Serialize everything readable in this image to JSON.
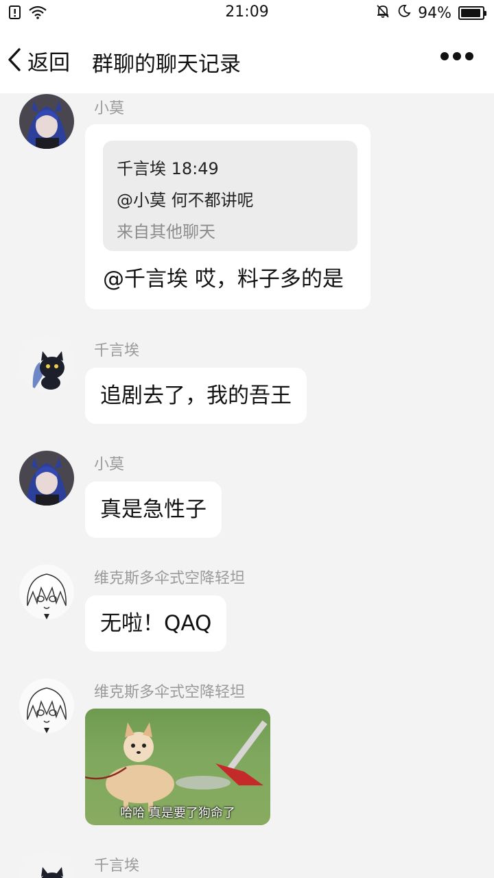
{
  "status_bar": {
    "time": "21:09",
    "battery": "94%",
    "icons": [
      "sim-alert-icon",
      "wifi-icon",
      "mute-bell-icon",
      "moon-icon",
      "battery-icon"
    ]
  },
  "header": {
    "back_label": "返回",
    "title": "群聊的聊天记录",
    "more_icon": "more-dots-icon"
  },
  "messages": [
    {
      "sender": "小莫",
      "quote": {
        "author_time": "千言埃 18:49",
        "text": "@小莫 何不都讲呢",
        "source": "来自其他聊天"
      },
      "text": "@千言埃 哎，料子多的是"
    },
    {
      "sender": "千言埃",
      "text": "追剧去了，我的吾王"
    },
    {
      "sender": "小莫",
      "text": "真是急性子"
    },
    {
      "sender": "维克斯多伞式空降轻坦",
      "text": "无啦！QAQ"
    },
    {
      "sender": "维克斯多伞式空降轻坦",
      "sticker_caption": "哈哈  真是要了狗命了"
    },
    {
      "sender": "千言埃"
    }
  ]
}
